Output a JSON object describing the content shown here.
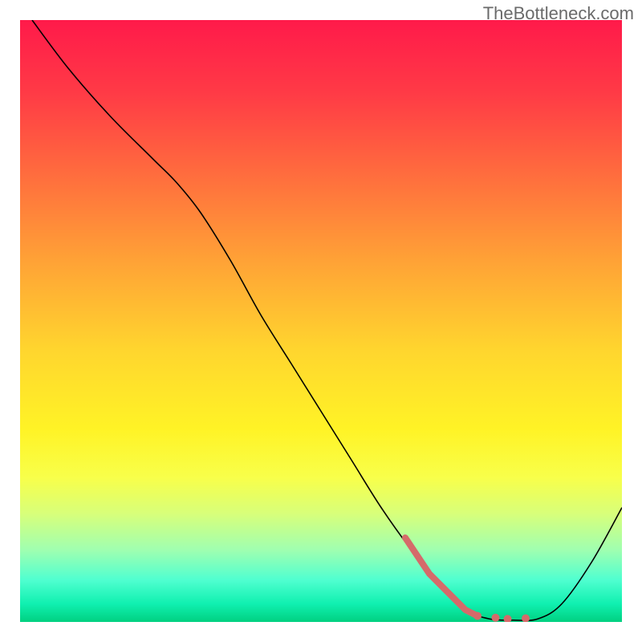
{
  "watermark": "TheBottleneck.com",
  "chart_data": {
    "type": "line",
    "title": "",
    "xlabel": "",
    "ylabel": "",
    "xlim": [
      0,
      100
    ],
    "ylim": [
      0,
      100
    ],
    "background_gradient": {
      "stops": [
        {
          "offset": 0,
          "color": "#ff1a4a"
        },
        {
          "offset": 12,
          "color": "#ff3a46"
        },
        {
          "offset": 25,
          "color": "#ff6a3e"
        },
        {
          "offset": 40,
          "color": "#ffa236"
        },
        {
          "offset": 55,
          "color": "#ffd62e"
        },
        {
          "offset": 68,
          "color": "#fff326"
        },
        {
          "offset": 76,
          "color": "#f8ff4a"
        },
        {
          "offset": 82,
          "color": "#d8ff7a"
        },
        {
          "offset": 88,
          "color": "#a0ffb0"
        },
        {
          "offset": 93,
          "color": "#50ffd0"
        },
        {
          "offset": 97,
          "color": "#10f0b0"
        },
        {
          "offset": 100,
          "color": "#00d080"
        }
      ]
    },
    "series": [
      {
        "name": "curve",
        "color": "#000000",
        "width": 1.6,
        "points": [
          {
            "x": 2,
            "y": 100
          },
          {
            "x": 8,
            "y": 92
          },
          {
            "x": 15,
            "y": 84
          },
          {
            "x": 22,
            "y": 77
          },
          {
            "x": 26,
            "y": 73
          },
          {
            "x": 30,
            "y": 68
          },
          {
            "x": 35,
            "y": 60
          },
          {
            "x": 40,
            "y": 51
          },
          {
            "x": 45,
            "y": 43
          },
          {
            "x": 50,
            "y": 35
          },
          {
            "x": 55,
            "y": 27
          },
          {
            "x": 60,
            "y": 19
          },
          {
            "x": 65,
            "y": 12
          },
          {
            "x": 70,
            "y": 6
          },
          {
            "x": 74,
            "y": 2
          },
          {
            "x": 78,
            "y": 0.5
          },
          {
            "x": 82,
            "y": 0.3
          },
          {
            "x": 86,
            "y": 0.5
          },
          {
            "x": 90,
            "y": 3
          },
          {
            "x": 95,
            "y": 10
          },
          {
            "x": 100,
            "y": 19
          }
        ]
      },
      {
        "name": "highlight",
        "color": "#d56a6a",
        "width": 8,
        "points": [
          {
            "x": 64,
            "y": 14
          },
          {
            "x": 66,
            "y": 11
          },
          {
            "x": 68,
            "y": 8
          },
          {
            "x": 70,
            "y": 6
          },
          {
            "x": 72,
            "y": 4
          },
          {
            "x": 74,
            "y": 2
          },
          {
            "x": 76,
            "y": 1
          }
        ]
      }
    ],
    "highlight_dots": {
      "color": "#d56a6a",
      "radius": 5,
      "points": [
        {
          "x": 76,
          "y": 1
        },
        {
          "x": 79,
          "y": 0.7
        },
        {
          "x": 81,
          "y": 0.5
        },
        {
          "x": 84,
          "y": 0.6
        }
      ]
    }
  }
}
